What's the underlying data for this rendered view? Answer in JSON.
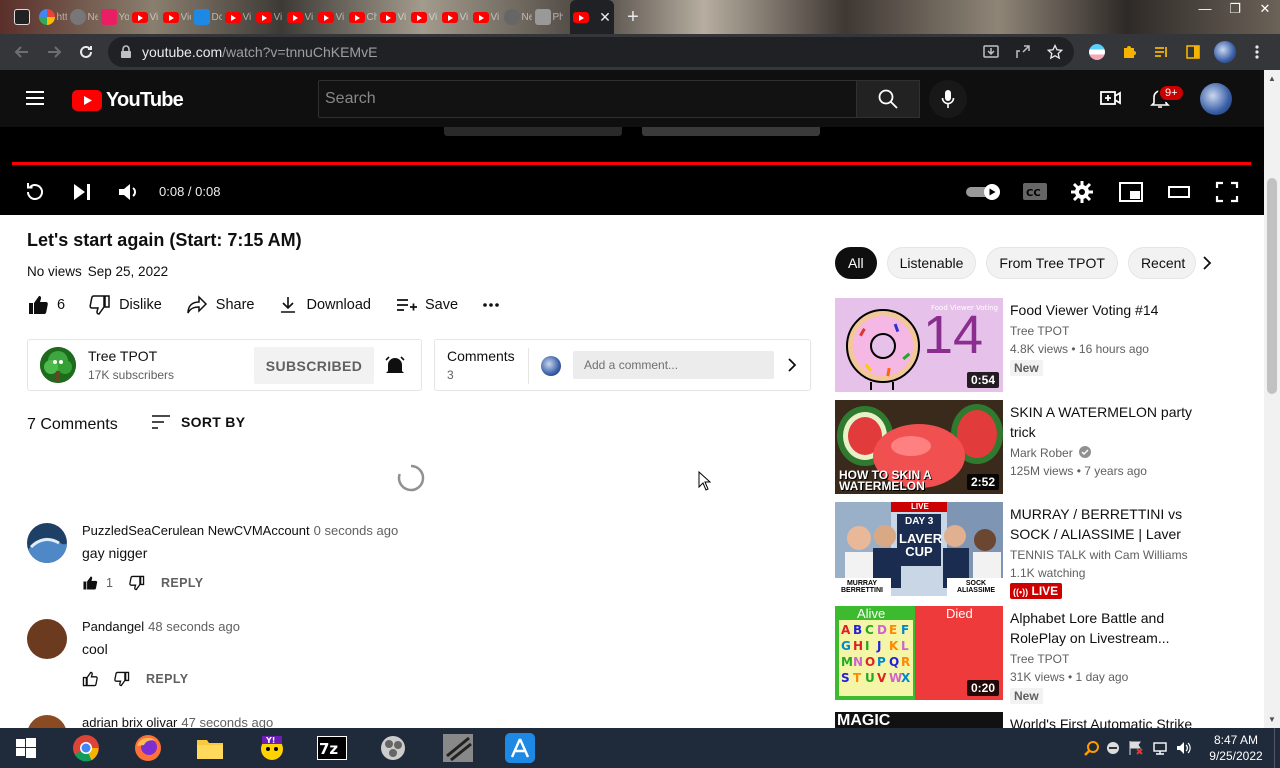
{
  "browser": {
    "url_domain": "youtube.com",
    "url_path": "/watch?v=tnnuChKEMvE",
    "tab_titles": [
      "htt",
      "Ne",
      "Yo",
      "Vi",
      "Vic",
      "Dc",
      "Vi",
      "Vi",
      "Vi",
      "Vi",
      "Ch",
      "Vi",
      "Vi",
      "Vi",
      "Vi",
      "Ne",
      "Pho"
    ],
    "new_tab_symbol": "+"
  },
  "youtube_header": {
    "brand": "YouTube",
    "search_placeholder": "Search",
    "notification_count": "9+"
  },
  "player": {
    "time": "0:08 / 0:08",
    "progress": 1.0
  },
  "video": {
    "title": "Let's start again (Start: 7:15 AM)",
    "views": "No views",
    "date": "Sep 25, 2022",
    "likes": "6",
    "dislike_label": "Dislike",
    "share_label": "Share",
    "download_label": "Download",
    "save_label": "Save"
  },
  "channel": {
    "name": "Tree TPOT",
    "subscribers": "17K subscribers",
    "subscribe_label": "SUBSCRIBED"
  },
  "comments_box": {
    "label": "Comments",
    "count": "3",
    "placeholder": "Add a comment..."
  },
  "comments_section": {
    "count_label": "7 Comments",
    "sort_label": "SORT BY",
    "reply_label": "REPLY",
    "items": [
      {
        "author": "PuzzledSeaCerulean NewCVMAccount",
        "time": "0 seconds ago",
        "text": "gay nigger",
        "likes": "1"
      },
      {
        "author": "Pandangel",
        "time": "48 seconds ago",
        "text": "cool",
        "likes": ""
      },
      {
        "author": "adrian brix olivar",
        "time": "47 seconds ago",
        "text": "",
        "likes": ""
      }
    ]
  },
  "chips": [
    "All",
    "Listenable",
    "From Tree TPOT",
    "Recent"
  ],
  "recommendations": [
    {
      "title": "Food Viewer Voting #14",
      "channel": "Tree TPOT",
      "meta": "4.8K views • 16 hours ago",
      "duration": "0:54",
      "badge": "New",
      "thumb_text": "14",
      "thumb_caption": "Food Viewer Voting"
    },
    {
      "title": "SKIN A WATERMELON party trick",
      "channel": "Mark Rober",
      "meta": "125M views • 7 years ago",
      "duration": "2:52",
      "thumb_text": "HOW TO SKIN A WATERMELON"
    },
    {
      "title": "MURRAY / BERRETTINI vs SOCK / ALIASSIME | Laver Cu...",
      "channel": "TENNIS TALK with Cam Williams",
      "meta": "1.1K watching",
      "badge": "LIVE",
      "thumb_text_1": "DAY 3",
      "thumb_text_2": "LAVER CUP",
      "thumb_text_3": "MURRAY BERRETTINI",
      "thumb_text_4": "SOCK ALIASSIME",
      "thumb_text_5": "LIVE"
    },
    {
      "title": "Alphabet Lore Battle and RolePlay on Livestream...",
      "channel": "Tree TPOT",
      "meta": "31K views • 1 day ago",
      "duration": "0:20",
      "badge": "New",
      "thumb_left": "Alive",
      "thumb_right": "Died"
    },
    {
      "title": "World's First Automatic Strike",
      "thumb_text": "MAGIC"
    }
  ],
  "taskbar": {
    "time": "8:47 AM",
    "date": "9/25/2022"
  },
  "colors": {
    "youtube_red": "#ff0000",
    "header_bg": "#0f0f0f",
    "taskbar_bg": "#1f2b3a",
    "browser_bg": "#35363a"
  }
}
